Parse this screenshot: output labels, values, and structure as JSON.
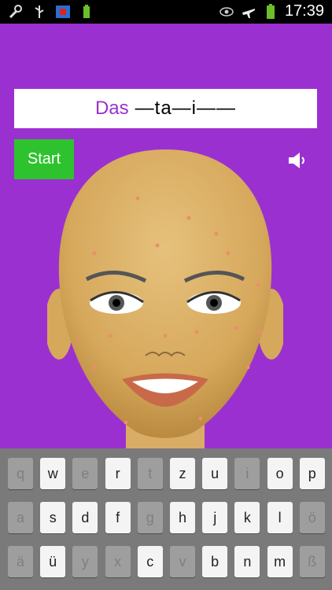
{
  "status_bar": {
    "time": "17:39",
    "left_icons": [
      "wrench-icon",
      "usb-icon",
      "app-icon",
      "battery-small-icon"
    ],
    "right_icons": [
      "eye-icon",
      "airplane-icon",
      "battery-icon"
    ]
  },
  "game": {
    "article": "Das",
    "pattern": "—ta—i——",
    "start_label": "Start",
    "sound_icon": "speaker-icon"
  },
  "keyboard": {
    "rows": [
      [
        {
          "label": "q",
          "enabled": false
        },
        {
          "label": "w",
          "enabled": true
        },
        {
          "label": "e",
          "enabled": false
        },
        {
          "label": "r",
          "enabled": true
        },
        {
          "label": "t",
          "enabled": false
        },
        {
          "label": "z",
          "enabled": true
        },
        {
          "label": "u",
          "enabled": true
        },
        {
          "label": "i",
          "enabled": false
        },
        {
          "label": "o",
          "enabled": true
        },
        {
          "label": "p",
          "enabled": true
        }
      ],
      [
        {
          "label": "a",
          "enabled": false
        },
        {
          "label": "s",
          "enabled": true
        },
        {
          "label": "d",
          "enabled": true
        },
        {
          "label": "f",
          "enabled": true
        },
        {
          "label": "g",
          "enabled": false
        },
        {
          "label": "h",
          "enabled": true
        },
        {
          "label": "j",
          "enabled": true
        },
        {
          "label": "k",
          "enabled": true
        },
        {
          "label": "l",
          "enabled": true
        },
        {
          "label": "ö",
          "enabled": false
        }
      ],
      [
        {
          "label": "ä",
          "enabled": false
        },
        {
          "label": "ü",
          "enabled": true
        },
        {
          "label": "y",
          "enabled": false
        },
        {
          "label": "x",
          "enabled": false
        },
        {
          "label": "c",
          "enabled": true
        },
        {
          "label": "v",
          "enabled": false
        },
        {
          "label": "b",
          "enabled": true
        },
        {
          "label": "n",
          "enabled": true
        },
        {
          "label": "m",
          "enabled": true
        },
        {
          "label": "ß",
          "enabled": false
        }
      ]
    ]
  },
  "colors": {
    "background": "#9b30d0",
    "start_button": "#2ec22e",
    "keyboard": "#7a7a7a"
  }
}
